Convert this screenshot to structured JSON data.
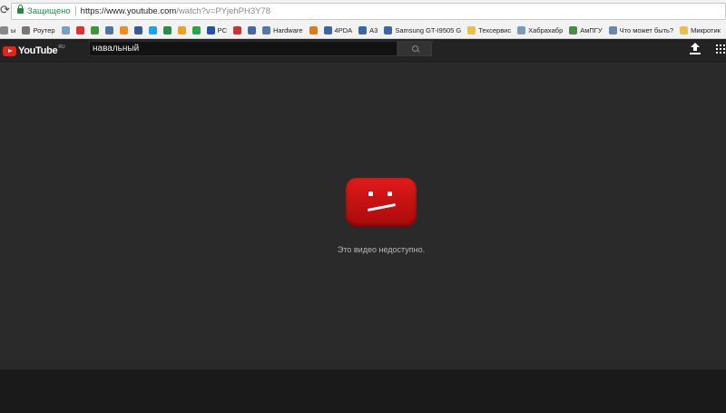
{
  "browser": {
    "reload_icon": "reload-icon",
    "secure_label": "Защищено",
    "url_host": "https://www.youtube.com",
    "url_rest": "/watch?v=PYjehPH3Y78"
  },
  "bookmarks": [
    {
      "label": "ы",
      "color": "#888888",
      "icon": "folder-icon"
    },
    {
      "label": "Роутер",
      "color": "#777777",
      "icon": "router-icon"
    },
    {
      "label": "",
      "color": "#7aa0c0",
      "icon": "site-icon"
    },
    {
      "label": "",
      "color": "#e03030",
      "icon": "yandex-icon"
    },
    {
      "label": "",
      "color": "#3a9a3a",
      "icon": "site-icon"
    },
    {
      "label": "",
      "color": "#4a76a8",
      "icon": "vk-icon"
    },
    {
      "label": "",
      "color": "#f28c1a",
      "icon": "odnoklassniki-icon"
    },
    {
      "label": "",
      "color": "#3b5998",
      "icon": "facebook-icon"
    },
    {
      "label": "",
      "color": "#1da1f2",
      "icon": "twitter-icon"
    },
    {
      "label": "",
      "color": "#2c8c4c",
      "icon": "site-icon"
    },
    {
      "label": "",
      "color": "#f0a020",
      "icon": "star-icon"
    },
    {
      "label": "",
      "color": "#2aa54a",
      "icon": "site-icon"
    },
    {
      "label": "PC",
      "color": "#2255aa",
      "icon": "pc-icon"
    },
    {
      "label": "",
      "color": "#d03030",
      "icon": "site-icon"
    },
    {
      "label": "",
      "color": "#4466aa",
      "icon": "site-icon"
    },
    {
      "label": "Hardware",
      "color": "#5577aa",
      "icon": "hardware-icon"
    },
    {
      "label": "",
      "color": "#e07a1a",
      "icon": "site-icon"
    },
    {
      "label": "4PDA",
      "color": "#3a66aa",
      "icon": "4pda-icon"
    },
    {
      "label": "A3",
      "color": "#3a66aa",
      "icon": "4pda-icon"
    },
    {
      "label": "Samsung GT-I9505 G",
      "color": "#3a66aa",
      "icon": "4pda-icon"
    },
    {
      "label": "Техсервис",
      "color": "#e8c04a",
      "icon": "folder-icon"
    },
    {
      "label": "Хабрахабр",
      "color": "#7a9ab8",
      "icon": "habr-icon"
    },
    {
      "label": "АмПГУ",
      "color": "#4a8a4a",
      "icon": "site-icon"
    },
    {
      "label": "Что может быть?",
      "color": "#6688aa",
      "icon": "site-icon"
    },
    {
      "label": "Микротик",
      "color": "#e8c04a",
      "icon": "folder-icon"
    }
  ],
  "youtube": {
    "logo_word": "YouTube",
    "region": "RU",
    "search_value": "навальный",
    "search_icon": "search-icon",
    "upload_icon": "upload-icon",
    "apps_icon": "apps-grid-icon"
  },
  "player": {
    "error_icon": "sad-face-icon",
    "error_color": "#cc1111",
    "error_message": "Это видео недоступно."
  }
}
